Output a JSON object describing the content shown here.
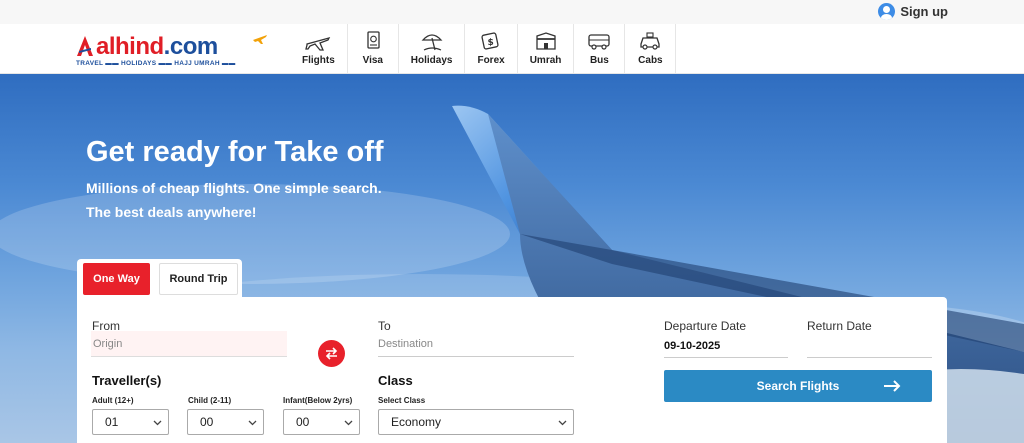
{
  "topbar": {
    "signup_label": "Sign up",
    "signup_icon": "user-icon"
  },
  "brand": {
    "logo_part1": "alhind",
    "logo_part2": ".com",
    "tagline": "TRAVEL ▬▬ HOLIDAYS ▬▬ HAJJ UMRAH ▬▬",
    "colors": {
      "red": "#e01e26",
      "blue": "#1d4f9c"
    }
  },
  "nav": {
    "items": [
      {
        "label": "Flights",
        "icon": "airplane-icon"
      },
      {
        "label": "Visa",
        "icon": "passport-icon"
      },
      {
        "label": "Holidays",
        "icon": "beach-umbrella-icon"
      },
      {
        "label": "Forex",
        "icon": "currency-icon"
      },
      {
        "label": "Umrah",
        "icon": "kaaba-icon"
      },
      {
        "label": "Bus",
        "icon": "bus-icon"
      },
      {
        "label": "Cabs",
        "icon": "car-icon"
      }
    ]
  },
  "hero": {
    "title": "Get ready for Take off",
    "subtitle_line1": "Millions of cheap flights. One simple search.",
    "subtitle_line2": "The best deals anywhere!"
  },
  "trip_tabs": {
    "one_way": "One Way",
    "round_trip": "Round Trip",
    "active": "One Way"
  },
  "search": {
    "from_label": "From",
    "from_placeholder": "Origin",
    "to_label": "To",
    "to_placeholder": "Destination",
    "departure_label": "Departure Date",
    "departure_value": "09-10-2025",
    "return_label": "Return Date",
    "return_value": "",
    "travellers_title": "Traveller(s)",
    "adult_label": "Adult (12+)",
    "adult_value": "01",
    "child_label": "Child (2-11)",
    "child_value": "00",
    "infant_label": "Infant(Below 2yrs)",
    "infant_value": "00",
    "class_title": "Class",
    "class_sublabel": "Select Class",
    "class_value": "Economy",
    "search_button": "Search Flights"
  },
  "theme": {
    "accent_red": "#e8212b",
    "search_blue": "#2b8ac4"
  }
}
